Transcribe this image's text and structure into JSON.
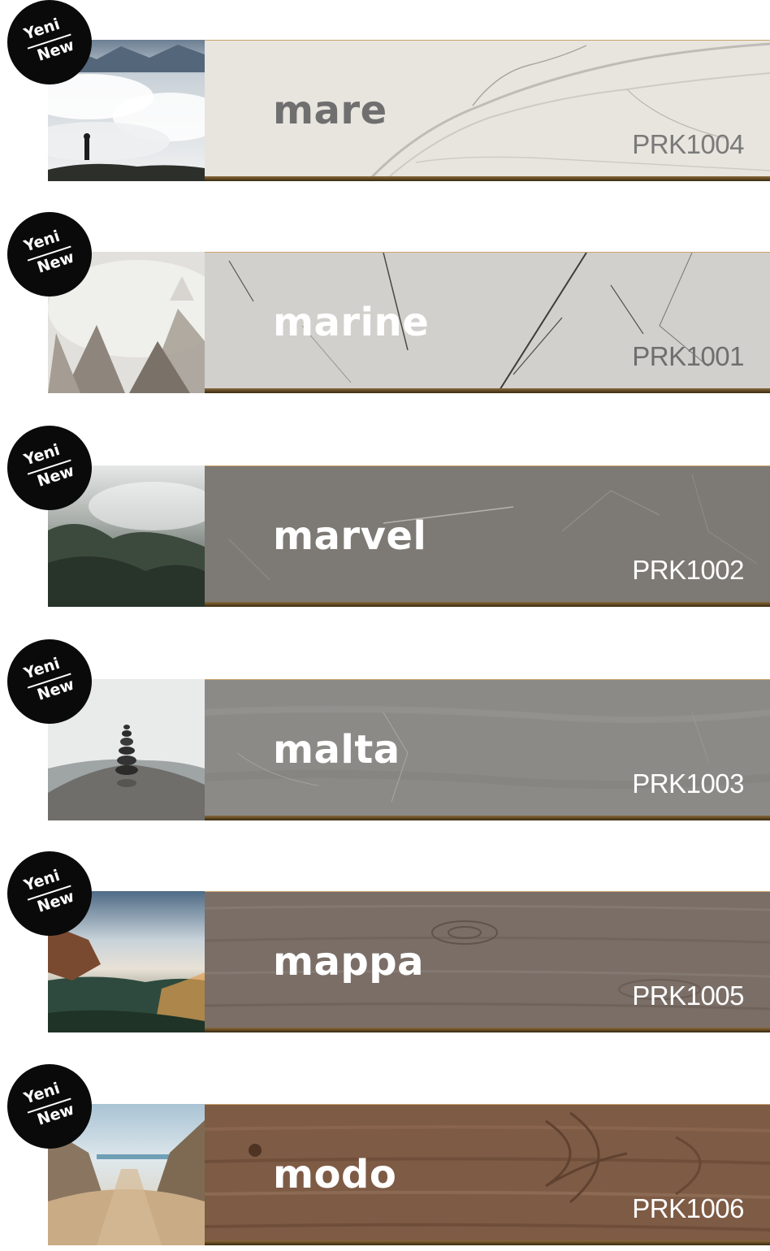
{
  "badge": {
    "line1": "Yeni",
    "line2": "New"
  },
  "products": [
    {
      "name": "mare",
      "code": "PRK1004",
      "slab_color": "#e8e5df",
      "name_color": "#6f6f6f",
      "code_color": "#7a7a7a",
      "photo": "misty-peak-hiker"
    },
    {
      "name": "marine",
      "code": "PRK1001",
      "slab_color": "#d2d0cc",
      "name_color": "#ffffff",
      "code_color": "#6e6e6e",
      "photo": "fog-rocks"
    },
    {
      "name": "marvel",
      "code": "PRK1002",
      "slab_color": "#7b7772",
      "name_color": "#ffffff",
      "code_color": "#ffffff",
      "photo": "foggy-forest"
    },
    {
      "name": "malta",
      "code": "PRK1003",
      "slab_color": "#8c8a87",
      "name_color": "#ffffff",
      "code_color": "#ffffff",
      "photo": "stone-cairn"
    },
    {
      "name": "mappa",
      "code": "PRK1005",
      "slab_color": "#7a6e67",
      "name_color": "#ffffff",
      "code_color": "#ffffff",
      "photo": "cliff-valley-sunset"
    },
    {
      "name": "modo",
      "code": "PRK1006",
      "slab_color": "#7e5b45",
      "name_color": "#ffffff",
      "code_color": "#ffffff",
      "photo": "sand-dunes-beach"
    }
  ]
}
